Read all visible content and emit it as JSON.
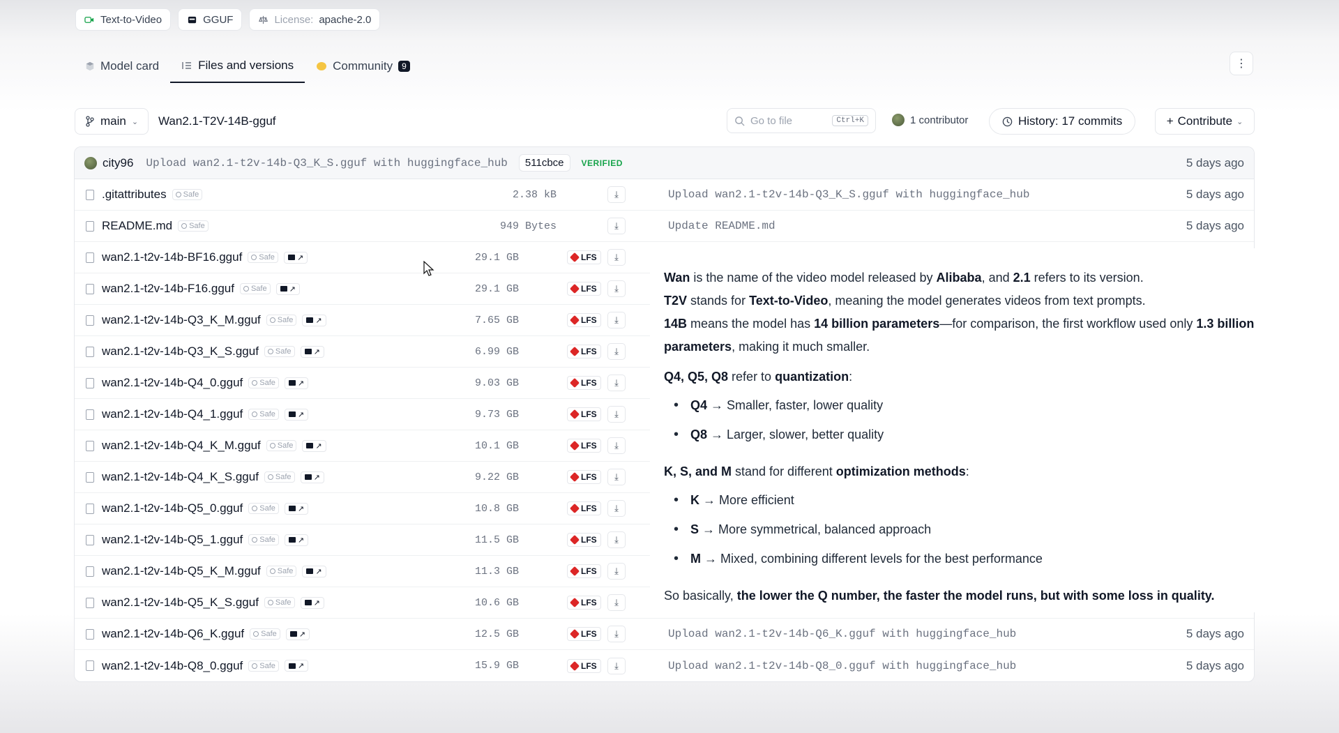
{
  "tags": [
    {
      "icon": "text-to-video-icon",
      "label": "Text-to-Video"
    },
    {
      "icon": "gguf-icon",
      "label": "GGUF"
    },
    {
      "icon": "license-icon",
      "key": "License:",
      "label": "apache-2.0"
    }
  ],
  "tabs": [
    {
      "label": "Model card"
    },
    {
      "label": "Files and versions"
    },
    {
      "label": "Community",
      "badge": "9"
    }
  ],
  "repo": {
    "branch": "main",
    "path": "Wan2.1-T2V-14B-gguf",
    "search_placeholder": "Go to file",
    "search_shortcut": "Ctrl+K",
    "contributors": "1 contributor",
    "history": "History: 17 commits",
    "contribute": "Contribute"
  },
  "last_commit": {
    "user": "city96",
    "message": "Upload wan2.1-t2v-14b-Q3_K_S.gguf with huggingface_hub",
    "hash": "511cbce",
    "verified": "VERIFIED",
    "time": "5 days ago"
  },
  "files": [
    {
      "name": ".gitattributes",
      "safe": "Safe",
      "size": "2.38 kB",
      "message": "Upload wan2.1-t2v-14b-Q3_K_S.gguf with huggingface_hub",
      "time": "5 days ago"
    },
    {
      "name": "README.md",
      "safe": "Safe",
      "size": "949 Bytes",
      "message": "Update README.md",
      "time": "5 days ago"
    },
    {
      "name": "wan2.1-t2v-14b-BF16.gguf",
      "safe": "Safe",
      "size": "29.1 GB",
      "lfs": "LFS"
    },
    {
      "name": "wan2.1-t2v-14b-F16.gguf",
      "safe": "Safe",
      "size": "29.1 GB",
      "lfs": "LFS"
    },
    {
      "name": "wan2.1-t2v-14b-Q3_K_M.gguf",
      "safe": "Safe",
      "size": "7.65 GB",
      "lfs": "LFS"
    },
    {
      "name": "wan2.1-t2v-14b-Q3_K_S.gguf",
      "safe": "Safe",
      "size": "6.99 GB",
      "lfs": "LFS"
    },
    {
      "name": "wan2.1-t2v-14b-Q4_0.gguf",
      "safe": "Safe",
      "size": "9.03 GB",
      "lfs": "LFS"
    },
    {
      "name": "wan2.1-t2v-14b-Q4_1.gguf",
      "safe": "Safe",
      "size": "9.73 GB",
      "lfs": "LFS"
    },
    {
      "name": "wan2.1-t2v-14b-Q4_K_M.gguf",
      "safe": "Safe",
      "size": "10.1 GB",
      "lfs": "LFS"
    },
    {
      "name": "wan2.1-t2v-14b-Q4_K_S.gguf",
      "safe": "Safe",
      "size": "9.22 GB",
      "lfs": "LFS"
    },
    {
      "name": "wan2.1-t2v-14b-Q5_0.gguf",
      "safe": "Safe",
      "size": "10.8 GB",
      "lfs": "LFS"
    },
    {
      "name": "wan2.1-t2v-14b-Q5_1.gguf",
      "safe": "Safe",
      "size": "11.5 GB",
      "lfs": "LFS"
    },
    {
      "name": "wan2.1-t2v-14b-Q5_K_M.gguf",
      "safe": "Safe",
      "size": "11.3 GB",
      "lfs": "LFS"
    },
    {
      "name": "wan2.1-t2v-14b-Q5_K_S.gguf",
      "safe": "Safe",
      "size": "10.6 GB",
      "lfs": "LFS"
    },
    {
      "name": "wan2.1-t2v-14b-Q6_K.gguf",
      "safe": "Safe",
      "size": "12.5 GB",
      "lfs": "LFS",
      "message": "Upload wan2.1-t2v-14b-Q6_K.gguf with huggingface_hub",
      "time": "5 days ago"
    },
    {
      "name": "wan2.1-t2v-14b-Q8_0.gguf",
      "safe": "Safe",
      "size": "15.9 GB",
      "lfs": "LFS",
      "message": "Upload wan2.1-t2v-14b-Q8_0.gguf with huggingface_hub",
      "time": "5 days ago"
    }
  ],
  "explanation": {
    "p1": [
      {
        "b": "Wan"
      },
      {
        "t": " is the name of the video model released by "
      },
      {
        "b": "Alibaba"
      },
      {
        "t": ", and "
      },
      {
        "b": "2.1"
      },
      {
        "t": " refers to its version."
      }
    ],
    "p2": [
      {
        "b": "T2V"
      },
      {
        "t": " stands for "
      },
      {
        "b": "Text-to-Video"
      },
      {
        "t": ", meaning the model generates videos from text prompts."
      }
    ],
    "p3": [
      {
        "b": "14B"
      },
      {
        "t": " means the model has "
      },
      {
        "b": "14 billion parameters"
      },
      {
        "t": "—for comparison, the first workflow used only "
      },
      {
        "b": "1.3 billion parameters"
      },
      {
        "t": ", making it much smaller."
      }
    ],
    "p4": [
      {
        "b": "Q4, Q5, Q8"
      },
      {
        "t": " refer to "
      },
      {
        "b": "quantization"
      },
      {
        "t": ":"
      }
    ],
    "quant_list": [
      [
        {
          "b": "Q4"
        },
        {
          "t": " → Smaller, faster, lower quality"
        }
      ],
      [
        {
          "b": "Q8"
        },
        {
          "t": " → Larger, slower, better quality"
        }
      ]
    ],
    "p5": [
      {
        "b": "K, S, and M"
      },
      {
        "t": " stand for different "
      },
      {
        "b": "optimization methods"
      },
      {
        "t": ":"
      }
    ],
    "opt_list": [
      [
        {
          "b": "K"
        },
        {
          "t": " → More efficient"
        }
      ],
      [
        {
          "b": "S"
        },
        {
          "t": " → More symmetrical, balanced approach"
        }
      ],
      [
        {
          "b": "M"
        },
        {
          "t": " → Mixed, combining different levels for the best performance"
        }
      ]
    ],
    "p6": [
      {
        "t": "So basically, "
      },
      {
        "b": "the lower the Q number, the faster the model runs, but with some loss in quality."
      }
    ]
  }
}
